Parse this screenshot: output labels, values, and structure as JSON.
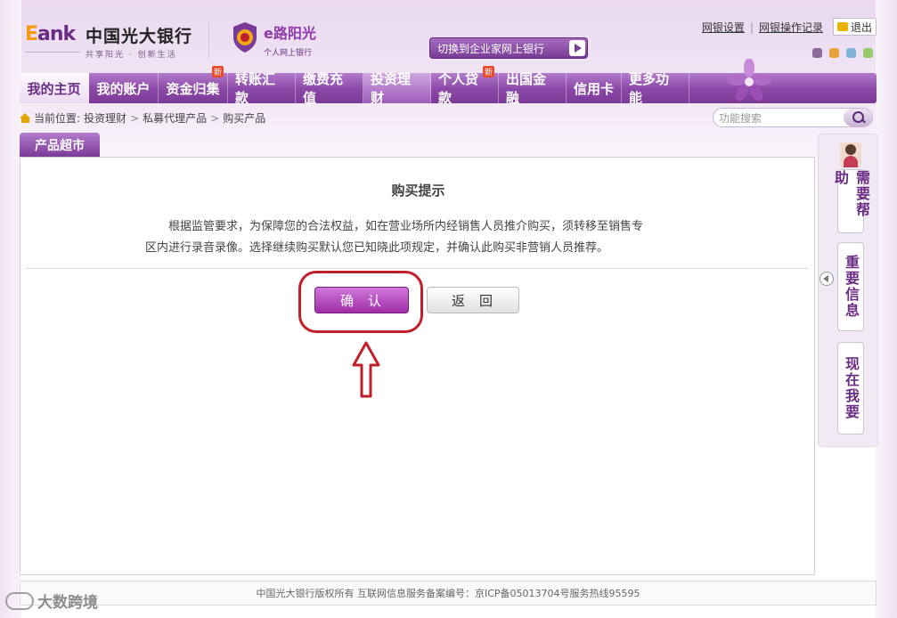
{
  "header": {
    "logo_e": "E",
    "logo_ank": "ank",
    "bank_name": "中国光大银行",
    "slogan": "共享阳光 · 创新生活",
    "sun_brand": "e路阳光",
    "sun_sub": "个人网上银行",
    "switch_label": "切换到企业家网上银行",
    "links": [
      "网银设置",
      "网银操作记录"
    ],
    "logout_label": "退出",
    "dot_colors": [
      "#8c6a99",
      "#e8a23a",
      "#7fb3d6",
      "#98c96a"
    ]
  },
  "nav": {
    "items": [
      {
        "label": "我的主页",
        "badge": ""
      },
      {
        "label": "我的账户",
        "badge": ""
      },
      {
        "label": "资金归集",
        "badge": "新"
      },
      {
        "label": "转账汇款",
        "badge": ""
      },
      {
        "label": "缴费充值",
        "badge": ""
      },
      {
        "label": "投资理财",
        "badge": ""
      },
      {
        "label": "个人贷款",
        "badge": "新"
      },
      {
        "label": "出国金融",
        "badge": ""
      },
      {
        "label": "信用卡",
        "badge": ""
      },
      {
        "label": "更多功能",
        "badge": ""
      }
    ]
  },
  "breadcrumb": {
    "prefix": "当前位置:",
    "items": [
      "投资理财",
      "私募代理产品",
      "购买产品"
    ]
  },
  "search": {
    "placeholder": "功能搜索"
  },
  "panel": {
    "tab_label": "产品超市",
    "title": "购买提示",
    "text_line1": "根据监管要求，为保障您的合法权益，如在营业场所内经销售人员推介购买，须转移至销售专",
    "text_line2": "区内进行录音录像。选择继续购买默认您已知晓此项规定，并确认此购买非营销人员推荐。",
    "confirm_label": "确认",
    "back_label": "返回"
  },
  "sidebar": {
    "items": [
      "需要帮助",
      "重要信息",
      "现在我要"
    ]
  },
  "footer": {
    "text": "中国光大银行版权所有 互联网信息服务备案编号：京ICP备05013704号服务热线95595"
  },
  "watermark": {
    "text": "大数跨境"
  },
  "colors": {
    "accent": "#7a3a97",
    "highlight": "#c0202a"
  }
}
